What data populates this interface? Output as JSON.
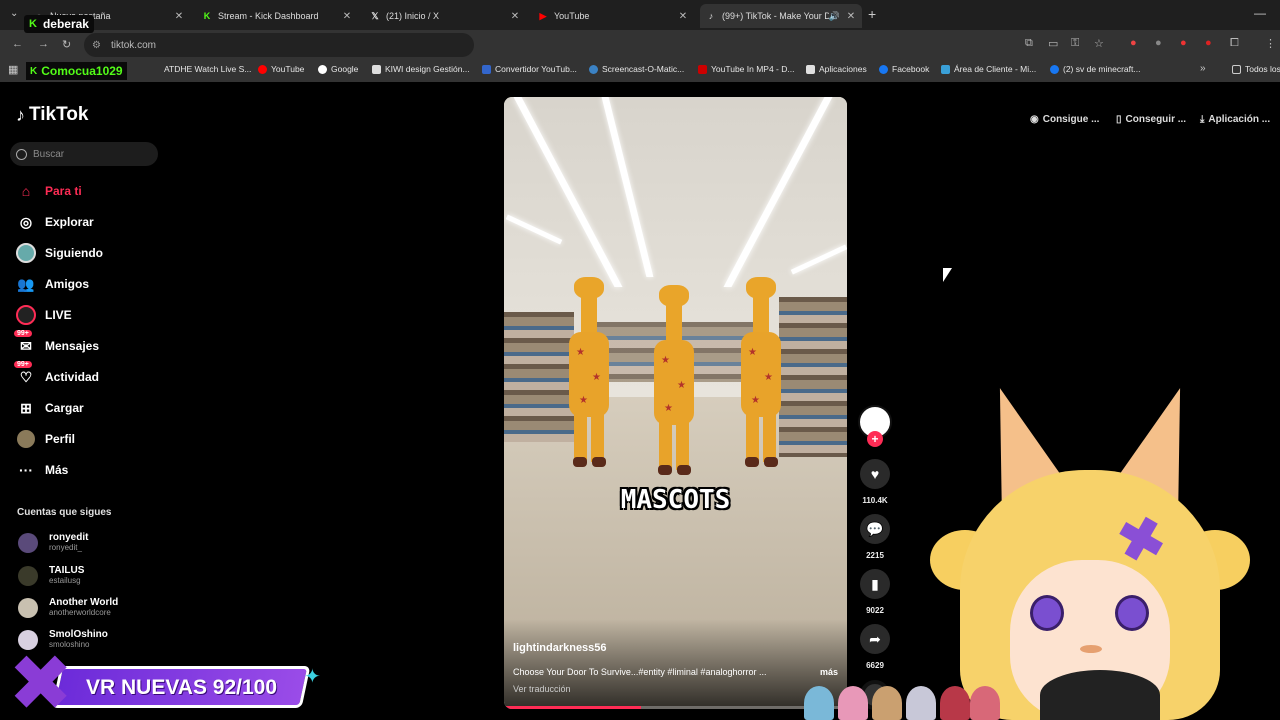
{
  "browser": {
    "tabs": [
      {
        "title": "Nueva pestaña",
        "icon": "new-tab-icon",
        "active": false
      },
      {
        "title": "Stream - Kick Dashboard",
        "icon": "kick-icon",
        "active": false
      },
      {
        "title": "(21) Inicio / X",
        "icon": "x-icon",
        "active": false
      },
      {
        "title": "YouTube",
        "icon": "youtube-icon",
        "active": false
      },
      {
        "title": "(99+) TikTok - Make Your Da",
        "icon": "tiktok-icon",
        "active": true
      }
    ],
    "url": "tiktok.com",
    "bookmarks": [
      {
        "label": "Comocua1029",
        "color": "#53fc18"
      },
      {
        "label": "ATDHE Watch Live S...",
        "color": "#888888"
      },
      {
        "label": "YouTube",
        "color": "#ff0000"
      },
      {
        "label": "Google",
        "color": "#ffffff"
      },
      {
        "label": "KIWI design Gestión...",
        "color": "#dddddd"
      },
      {
        "label": "Convertidor YouTub...",
        "color": "#3366cc"
      },
      {
        "label": "Screencast-O-Matic...",
        "color": "#3b82c4"
      },
      {
        "label": "YouTube In MP4 - D...",
        "color": "#cc0000"
      },
      {
        "label": "Aplicaciones",
        "color": "#e0e0e0"
      },
      {
        "label": "Facebook",
        "color": "#1877f2"
      },
      {
        "label": "Área de Cliente - Mi...",
        "color": "#3aa0d8"
      },
      {
        "label": "(2) sv de minecraft...",
        "color": "#1877f2"
      },
      {
        "label": "Todos los",
        "color": "#cccccc"
      }
    ]
  },
  "kick": {
    "badge_name": "deberak",
    "badge_channel": "Comocua1029"
  },
  "tiktok": {
    "logo": "TikTok",
    "search_placeholder": "Buscar",
    "nav": [
      {
        "label": "Para ti",
        "icon": "home-icon",
        "active": true
      },
      {
        "label": "Explorar",
        "icon": "compass-icon"
      },
      {
        "label": "Siguiendo",
        "icon": "following-icon"
      },
      {
        "label": "Amigos",
        "icon": "friends-icon"
      },
      {
        "label": "LIVE",
        "icon": "live-icon"
      },
      {
        "label": "Mensajes",
        "icon": "messages-icon",
        "badge": "99+"
      },
      {
        "label": "Actividad",
        "icon": "activity-icon",
        "badge": "99+"
      },
      {
        "label": "Cargar",
        "icon": "upload-icon"
      },
      {
        "label": "Perfil",
        "icon": "profile-icon"
      },
      {
        "label": "Más",
        "icon": "more-icon"
      }
    ],
    "following_title": "Cuentas que sigues",
    "following": [
      {
        "name": "ronyedit",
        "handle": "ronyedit_",
        "color": "#5a4a7a"
      },
      {
        "name": "TAILUS",
        "handle": "estailusg",
        "color": "#3a3a2a"
      },
      {
        "name": "Another World",
        "handle": "anotherworldcore",
        "color": "#c8c0b0"
      },
      {
        "name": "SmolOshino",
        "handle": "smoloshino",
        "color": "#d8d0e0"
      }
    ],
    "top_buttons": [
      {
        "label": "Consigue ...",
        "icon": "coin-icon"
      },
      {
        "label": "Conseguir ...",
        "icon": "phone-icon"
      },
      {
        "label": "Aplicación ...",
        "icon": "download-icon"
      }
    ],
    "video": {
      "overlay_text": "MASCOTS",
      "author": "lightindarkness56",
      "description": "Choose Your Door To Survive...#entity #liminal #analoghorror ...",
      "more": "más",
      "translate": "Ver traducción",
      "progress": 0.4
    },
    "actions": {
      "likes": "110.4K",
      "comments": "2215",
      "saves": "9022",
      "shares": "6629"
    }
  },
  "overlay": {
    "goal_text": "VR NUEVAS 92/100"
  }
}
